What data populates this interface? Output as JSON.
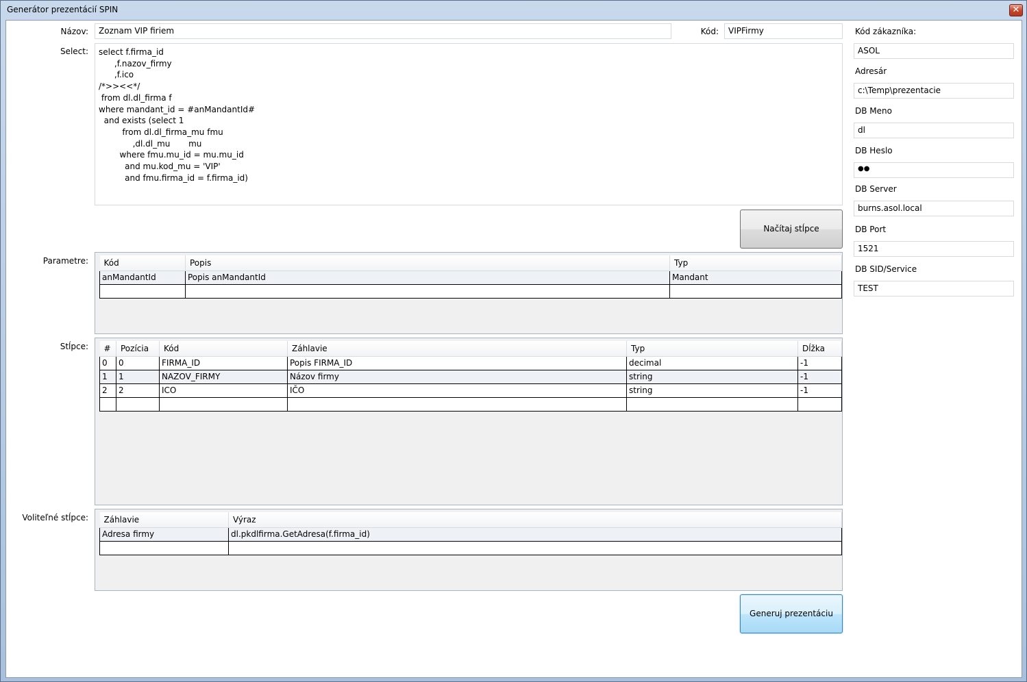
{
  "window": {
    "title": "Generátor prezentácií SPIN",
    "close_glyph": "✕"
  },
  "form": {
    "nazov_label": "Názov:",
    "nazov_value": "Zoznam VIP firiem",
    "kod_label": "Kód:",
    "kod_value": "VIPFirmy",
    "select_label": "Select:",
    "select_value": "select f.firma_id\n      ,f.nazov_firmy\n      ,f.ico\n/*>><<*/\n from dl.dl_firma f\nwhere mandant_id = #anMandantId#\n  and exists (select 1\n         from dl.dl_firma_mu fmu\n             ,dl.dl_mu       mu\n        where fmu.mu_id = mu.mu_id\n          and mu.kod_mu = 'VIP'\n          and fmu.firma_id = f.firma_id)",
    "load_button": "Načítaj stĺpce",
    "generate_button": "Generuj prezentáciu"
  },
  "parameters": {
    "label": "Parametre:",
    "columns": [
      "Kód",
      "Popis",
      "Typ"
    ],
    "rows": [
      [
        "anMandantId",
        "Popis anMandantId",
        "Mandant"
      ]
    ]
  },
  "columns_grid": {
    "label": "Stĺpce:",
    "columns": [
      "#",
      "Pozícia",
      "Kód",
      "Záhlavie",
      "Typ",
      "Dĺžka"
    ],
    "rows": [
      [
        "0",
        "0",
        "FIRMA_ID",
        "Popis FIRMA_ID",
        "decimal",
        "-1"
      ],
      [
        "1",
        "1",
        "NAZOV_FIRMY",
        "Názov firmy",
        "string",
        "-1"
      ],
      [
        "2",
        "2",
        "ICO",
        "IČO",
        "string",
        "-1"
      ]
    ]
  },
  "optional_columns": {
    "label": "Voliteľné stĺpce:",
    "columns": [
      "Záhlavie",
      "Výraz"
    ],
    "rows": [
      [
        "Adresa firmy",
        "dl.pkdlfirma.GetAdresa(f.firma_id)"
      ]
    ]
  },
  "connection": {
    "kod_zakaznika_label": "Kód zákazníka:",
    "kod_zakaznika_value": "ASOL",
    "adresar_label": "Adresár",
    "adresar_value": "c:\\Temp\\prezentacie",
    "db_meno_label": "DB Meno",
    "db_meno_value": "dl",
    "db_heslo_label": "DB Heslo",
    "db_heslo_value": "●●",
    "db_server_label": "DB Server",
    "db_server_value": "burns.asol.local",
    "db_port_label": "DB Port",
    "db_port_value": "1521",
    "db_sid_label": "DB SID/Service",
    "db_sid_value": "TEST"
  }
}
